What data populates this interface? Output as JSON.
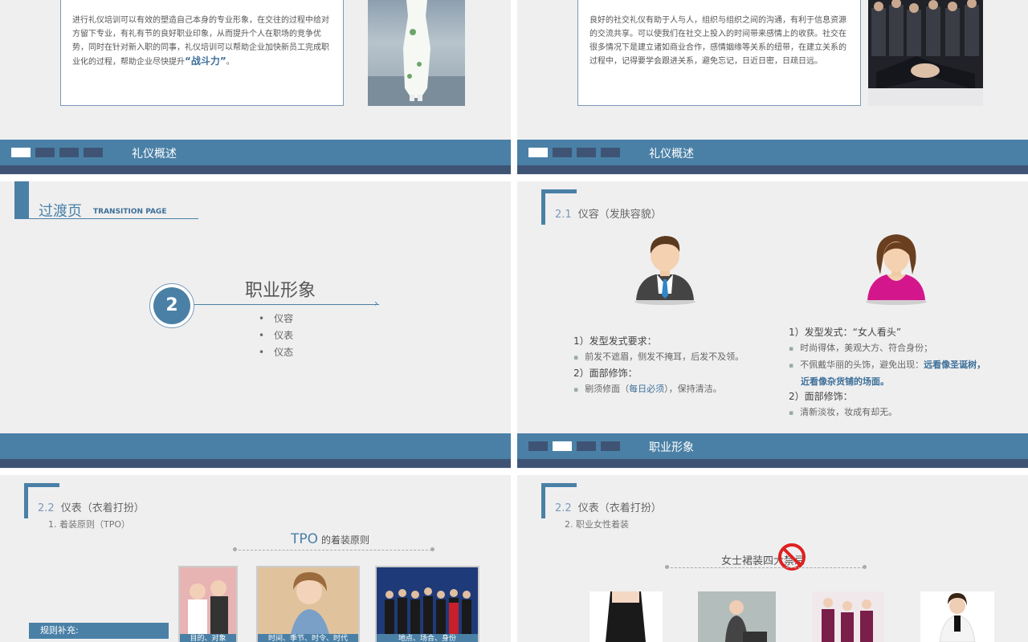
{
  "slide1": {
    "text": "进行礼仪培训可以有效的塑造自己本身的专业形象，在交往的过程中给对方留下专业，有礼有节的良好职业印象，从而提升个人在职场的竞争优势，同时在针对新入职的同事，礼仪培训可以帮助企业加快新员工完成职业化的过程，帮助企业尽快提升",
    "highlight": "“战斗力”",
    "end": "。",
    "band_title": "礼仪概述"
  },
  "slide2": {
    "text": "良好的社交礼仪有助于人与人，组织与组织之间的沟通，有利于信息资源的交流共享。可以使我们在社交上投入的时间带来感情上的收获。社交在很多情况下是建立诸如商业合作，感情姻缘等关系的纽带，在建立关系的过程中，记得要学会跟进关系，避免忘记，日近日密，日疏日远。",
    "band_title": "礼仪概述"
  },
  "slide3": {
    "header": "过渡页",
    "header_en": "TRANSITION PAGE",
    "number": "2",
    "title": "职业形象",
    "items": [
      "仪容",
      "仪表",
      "仪态"
    ]
  },
  "slide4": {
    "section_num": "2.1",
    "section_title": "仪容（发肤容貌）",
    "male": {
      "h1": "1）发型发式要求：",
      "b1": "前发不遮眉，侧发不掩耳，后发不及领。",
      "h2": "2）面部修饰：",
      "b2_pre": "剔须修面（",
      "b2_em": "每日必须",
      "b2_post": "），保持清洁。"
    },
    "female": {
      "h1": "1）发型发式：“女人看头”",
      "b1": "时尚得体，美观大方、符合身份；",
      "b2_pre": "不佩戴华丽的头饰，避免出现：",
      "b2_em1": "远看像圣诞树，",
      "b2_em2": "近看像杂货铺的场面。",
      "h2": "2）面部修饰：",
      "b3": "清新淡妆，妆成有却无。"
    },
    "band_title": "职业形象"
  },
  "slide5": {
    "section_num": "2.2",
    "section_title": "仪表（衣着打扮）",
    "sub": "1. 着装原则（TPO）",
    "tpo_a": "TPO",
    "tpo_b": "的着装原则",
    "rule_label": "规则补充:",
    "cards": [
      "目的、对象",
      "时间、季节、时令、时代",
      "地点、场合、身份"
    ]
  },
  "slide6": {
    "section_num": "2.2",
    "section_title": "仪表（衣着打扮）",
    "sub": "2. 职业女性着装",
    "title": "女士裙装四大禁忌"
  }
}
